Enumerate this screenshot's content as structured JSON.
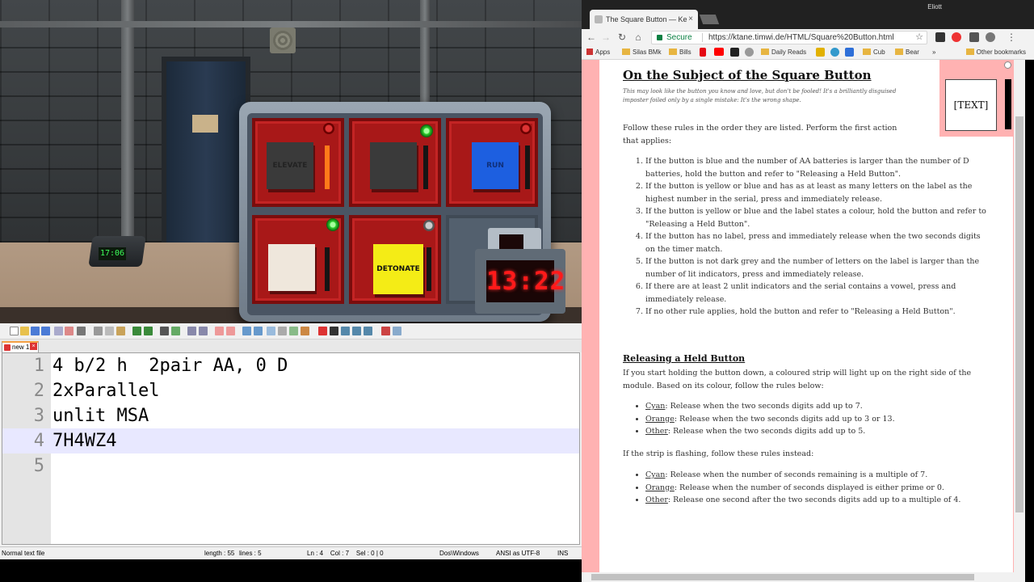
{
  "game": {
    "alarm_clock_time": "17:06",
    "timer": "13:22",
    "modules": {
      "top_left_button_label": "ELEVATE",
      "top_right_button_label": "RUN",
      "bottom_middle_button_label": "DETONATE"
    },
    "colors": {
      "module_red": "#a81818",
      "button_blue": "#1d5fe0",
      "button_yellow": "#f4ec16",
      "button_white": "#efe7dc",
      "button_dark": "#3a3a3a",
      "strip_orange": "#ff7a1a",
      "led_green": "#2ed12e",
      "timer_red": "#ff1a1a"
    }
  },
  "notepad": {
    "tab_label": "new 1",
    "lines": [
      {
        "num": "1",
        "text": "4 b/2 h  2pair AA, 0 D"
      },
      {
        "num": "2",
        "text": "2xParallel"
      },
      {
        "num": "3",
        "text": "unlit MSA"
      },
      {
        "num": "4",
        "text": "7H4WZ4"
      },
      {
        "num": "5",
        "text": ""
      }
    ],
    "status": {
      "type": "Normal text file",
      "length": "length : 55",
      "lines": "lines : 5",
      "position": "Ln : 4    Col : 7    Sel : 0 | 0",
      "eol": "Dos\\Windows",
      "encoding": "ANSI as UTF-8",
      "mode": "INS"
    }
  },
  "browser": {
    "user": "Eliott",
    "tab_title": "The Square Button — Ke",
    "tab_close": "×",
    "secure_label": "Secure",
    "url": "https://ktane.timwi.de/HTML/Square%20Button.html",
    "bookmarks": [
      "Apps",
      "Silas BMk",
      "Bills",
      "Daily Reads",
      "Cub",
      "Bear"
    ],
    "bookmarks_overflow": "»",
    "other_bookmarks": "Other bookmarks"
  },
  "manual": {
    "title": "On the Subject of the Square Button",
    "intro": "This may look like the button you know and love, but don't be fooled! It's a brilliantly disguised imposter foiled only by a single mistake: It's the wrong shape.",
    "follow": "Follow these rules in the order they are listed. Perform the first action that applies:",
    "rules": [
      "If the button is blue and the number of AA batteries is larger than the number of D batteries, hold the button and refer to \"Releasing a Held Button\".",
      "If the button is yellow or blue and has as at least as many letters on the label as the highest number in the serial, press and immediately release.",
      "If the button is yellow or blue and the label states a colour, hold the button and refer to \"Releasing a Held Button\".",
      "If the button has no label, press and immediately release when the two seconds digits on the timer match.",
      "If the button is not dark grey and the number of letters on the label is larger than the number of lit indicators, press and immediately release.",
      "If there are at least 2 unlit indicators and the serial contains a vowel, press and immediately release.",
      "If no other rule applies, hold the button and refer to \"Releasing a Held Button\"."
    ],
    "diagram_label": "[TEXT]",
    "release_heading": "Releasing a Held Button",
    "release_intro": "If you start holding the button down, a coloured strip will light up on the right side of the module. Based on its colour, follow the rules below:",
    "release_rules": [
      {
        "color": "Cyan",
        "text": ": Release when the two seconds digits add up to 7."
      },
      {
        "color": "Orange",
        "text": ": Release when the two seconds digits add up to 3 or 13."
      },
      {
        "color": "Other",
        "text": ": Release when the two seconds digits add up to 5."
      }
    ],
    "flash_intro": "If the strip is flashing, follow these rules instead:",
    "flash_rules": [
      {
        "color": "Cyan",
        "text": ": Release when the number of seconds remaining is a multiple of 7."
      },
      {
        "color": "Orange",
        "text": ": Release when the number of seconds displayed is either prime or 0."
      },
      {
        "color": "Other",
        "text": ": Release one second after the two seconds digits add up to a multiple of 4."
      }
    ]
  }
}
